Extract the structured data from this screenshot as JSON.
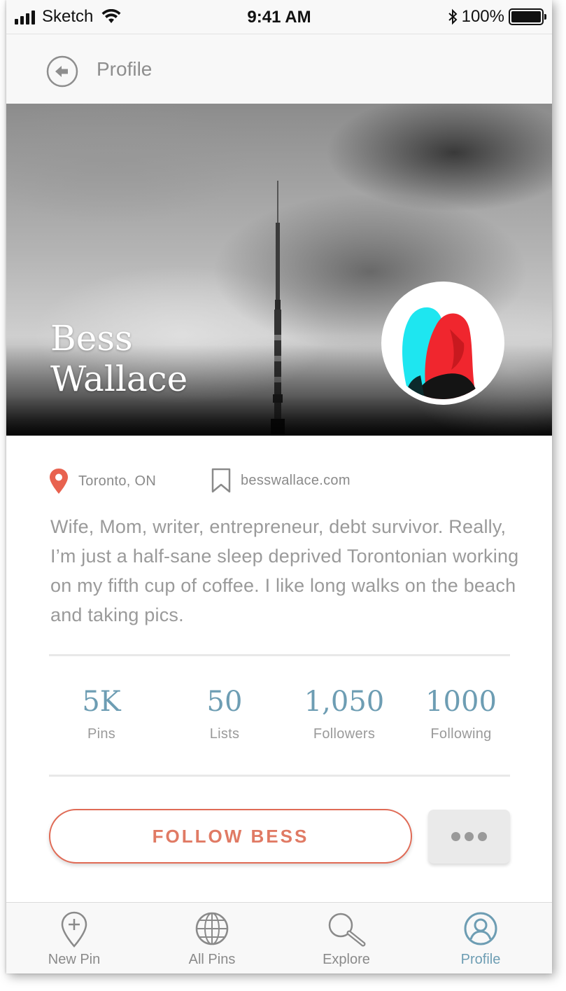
{
  "status_bar": {
    "carrier": "Sketch",
    "time": "9:41 AM",
    "battery_percent": "100%",
    "battery_level": 1.0,
    "icons": [
      "signal-icon",
      "wifi-icon",
      "bluetooth-icon",
      "battery-icon"
    ]
  },
  "header": {
    "back_icon": "back-arrow-icon",
    "title": "Profile"
  },
  "profile": {
    "first_name": "Bess",
    "last_name": "Wallace",
    "location": "Toronto, ON",
    "website": "besswallace.com",
    "bio": "Wife, Mom, writer, entrepreneur, debt survivor. Really, I’m just a half-sane sleep deprived Torontonian working on my fifth cup of coffee. I like long walks on the beach and taking pics."
  },
  "stats": [
    {
      "value": "5K",
      "label": "Pins"
    },
    {
      "value": "50",
      "label": "Lists"
    },
    {
      "value": "1,050",
      "label": "Followers"
    },
    {
      "value": "1000",
      "label": "Following"
    }
  ],
  "actions": {
    "follow_label": "FOLLOW BESS",
    "more_icon": "more-dots-icon"
  },
  "tab_bar": {
    "items": [
      {
        "label": "New Pin",
        "icon": "pin-plus-icon",
        "active": false
      },
      {
        "label": "All Pins",
        "icon": "globe-icon",
        "active": false
      },
      {
        "label": "Explore",
        "icon": "search-icon",
        "active": false
      },
      {
        "label": "Profile",
        "icon": "profile-icon",
        "active": true
      }
    ]
  },
  "colors": {
    "accent": "#6d9db3",
    "follow": "#e06a55",
    "location_pin": "#e8624f",
    "muted_text": "#9a9a9a"
  }
}
